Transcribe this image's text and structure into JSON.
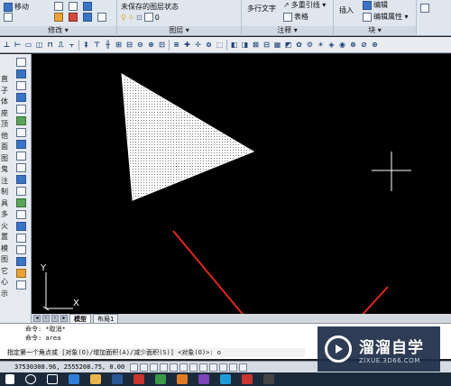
{
  "ribbon": {
    "modify_panel": {
      "title": "修改 ▾",
      "move_label": "移动"
    },
    "layers_panel": {
      "title": "图层 ▾",
      "layer_state": "未保存的图层状态",
      "layer_value": "0"
    },
    "annotation_panel": {
      "title": "注释 ▾",
      "mtext_label": "多行文字",
      "mleader_label": "多重引线 ▾",
      "table_label": "表格"
    },
    "block_panel": {
      "title": "块 ▾",
      "insert_label": "插入",
      "edit_label": "编辑",
      "edit_attr_label": "编辑属性 ▾"
    }
  },
  "left_toolbar": {
    "vertical_text": [
      "直",
      "子",
      "体",
      "座",
      "顶",
      "他",
      "面",
      "图",
      "鬼",
      "注",
      "制",
      "具",
      "多",
      "火",
      "置",
      "模",
      "图",
      "它",
      "心",
      "示"
    ]
  },
  "layout_tabs": {
    "model": "模型",
    "layout1": "布局1"
  },
  "ucs": {
    "x_label": "X",
    "y_label": "Y"
  },
  "command": {
    "line1": "命令: *取消*",
    "line2": "命令: area",
    "prompt": "指定第一个角点或 [对象(O)/增加面积(A)/减少面积(S)] <对象(O)>: o"
  },
  "status": {
    "coordinates": "37530308.96, 2555208.75, 0.00"
  },
  "watermark": {
    "title": "溜溜自学",
    "url": "ZIXUE.3D66.COM"
  },
  "colors": {
    "canvas_bg": "#000000",
    "triangle_fill": "#ffffff",
    "arrow": "#e0281e",
    "watermark_bg": "#1c2c46"
  }
}
